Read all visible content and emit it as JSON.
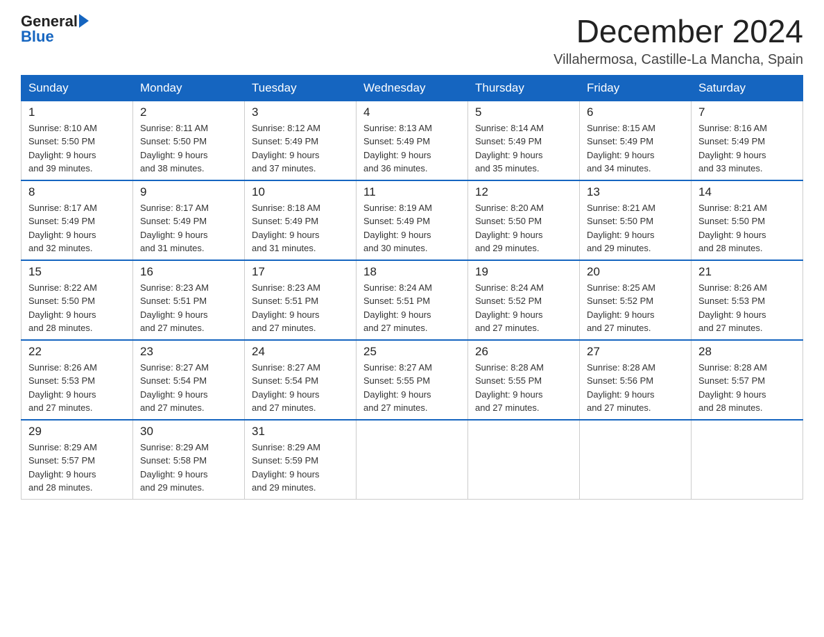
{
  "logo": {
    "general": "General",
    "blue": "Blue"
  },
  "title": {
    "month": "December 2024",
    "location": "Villahermosa, Castille-La Mancha, Spain"
  },
  "weekdays": [
    "Sunday",
    "Monday",
    "Tuesday",
    "Wednesday",
    "Thursday",
    "Friday",
    "Saturday"
  ],
  "weeks": [
    [
      {
        "day": "1",
        "sunrise": "8:10 AM",
        "sunset": "5:50 PM",
        "daylight": "9 hours and 39 minutes."
      },
      {
        "day": "2",
        "sunrise": "8:11 AM",
        "sunset": "5:50 PM",
        "daylight": "9 hours and 38 minutes."
      },
      {
        "day": "3",
        "sunrise": "8:12 AM",
        "sunset": "5:49 PM",
        "daylight": "9 hours and 37 minutes."
      },
      {
        "day": "4",
        "sunrise": "8:13 AM",
        "sunset": "5:49 PM",
        "daylight": "9 hours and 36 minutes."
      },
      {
        "day": "5",
        "sunrise": "8:14 AM",
        "sunset": "5:49 PM",
        "daylight": "9 hours and 35 minutes."
      },
      {
        "day": "6",
        "sunrise": "8:15 AM",
        "sunset": "5:49 PM",
        "daylight": "9 hours and 34 minutes."
      },
      {
        "day": "7",
        "sunrise": "8:16 AM",
        "sunset": "5:49 PM",
        "daylight": "9 hours and 33 minutes."
      }
    ],
    [
      {
        "day": "8",
        "sunrise": "8:17 AM",
        "sunset": "5:49 PM",
        "daylight": "9 hours and 32 minutes."
      },
      {
        "day": "9",
        "sunrise": "8:17 AM",
        "sunset": "5:49 PM",
        "daylight": "9 hours and 31 minutes."
      },
      {
        "day": "10",
        "sunrise": "8:18 AM",
        "sunset": "5:49 PM",
        "daylight": "9 hours and 31 minutes."
      },
      {
        "day": "11",
        "sunrise": "8:19 AM",
        "sunset": "5:49 PM",
        "daylight": "9 hours and 30 minutes."
      },
      {
        "day": "12",
        "sunrise": "8:20 AM",
        "sunset": "5:50 PM",
        "daylight": "9 hours and 29 minutes."
      },
      {
        "day": "13",
        "sunrise": "8:21 AM",
        "sunset": "5:50 PM",
        "daylight": "9 hours and 29 minutes."
      },
      {
        "day": "14",
        "sunrise": "8:21 AM",
        "sunset": "5:50 PM",
        "daylight": "9 hours and 28 minutes."
      }
    ],
    [
      {
        "day": "15",
        "sunrise": "8:22 AM",
        "sunset": "5:50 PM",
        "daylight": "9 hours and 28 minutes."
      },
      {
        "day": "16",
        "sunrise": "8:23 AM",
        "sunset": "5:51 PM",
        "daylight": "9 hours and 27 minutes."
      },
      {
        "day": "17",
        "sunrise": "8:23 AM",
        "sunset": "5:51 PM",
        "daylight": "9 hours and 27 minutes."
      },
      {
        "day": "18",
        "sunrise": "8:24 AM",
        "sunset": "5:51 PM",
        "daylight": "9 hours and 27 minutes."
      },
      {
        "day": "19",
        "sunrise": "8:24 AM",
        "sunset": "5:52 PM",
        "daylight": "9 hours and 27 minutes."
      },
      {
        "day": "20",
        "sunrise": "8:25 AM",
        "sunset": "5:52 PM",
        "daylight": "9 hours and 27 minutes."
      },
      {
        "day": "21",
        "sunrise": "8:26 AM",
        "sunset": "5:53 PM",
        "daylight": "9 hours and 27 minutes."
      }
    ],
    [
      {
        "day": "22",
        "sunrise": "8:26 AM",
        "sunset": "5:53 PM",
        "daylight": "9 hours and 27 minutes."
      },
      {
        "day": "23",
        "sunrise": "8:27 AM",
        "sunset": "5:54 PM",
        "daylight": "9 hours and 27 minutes."
      },
      {
        "day": "24",
        "sunrise": "8:27 AM",
        "sunset": "5:54 PM",
        "daylight": "9 hours and 27 minutes."
      },
      {
        "day": "25",
        "sunrise": "8:27 AM",
        "sunset": "5:55 PM",
        "daylight": "9 hours and 27 minutes."
      },
      {
        "day": "26",
        "sunrise": "8:28 AM",
        "sunset": "5:55 PM",
        "daylight": "9 hours and 27 minutes."
      },
      {
        "day": "27",
        "sunrise": "8:28 AM",
        "sunset": "5:56 PM",
        "daylight": "9 hours and 27 minutes."
      },
      {
        "day": "28",
        "sunrise": "8:28 AM",
        "sunset": "5:57 PM",
        "daylight": "9 hours and 28 minutes."
      }
    ],
    [
      {
        "day": "29",
        "sunrise": "8:29 AM",
        "sunset": "5:57 PM",
        "daylight": "9 hours and 28 minutes."
      },
      {
        "day": "30",
        "sunrise": "8:29 AM",
        "sunset": "5:58 PM",
        "daylight": "9 hours and 29 minutes."
      },
      {
        "day": "31",
        "sunrise": "8:29 AM",
        "sunset": "5:59 PM",
        "daylight": "9 hours and 29 minutes."
      },
      null,
      null,
      null,
      null
    ]
  ],
  "labels": {
    "sunrise": "Sunrise:",
    "sunset": "Sunset:",
    "daylight": "Daylight:"
  }
}
